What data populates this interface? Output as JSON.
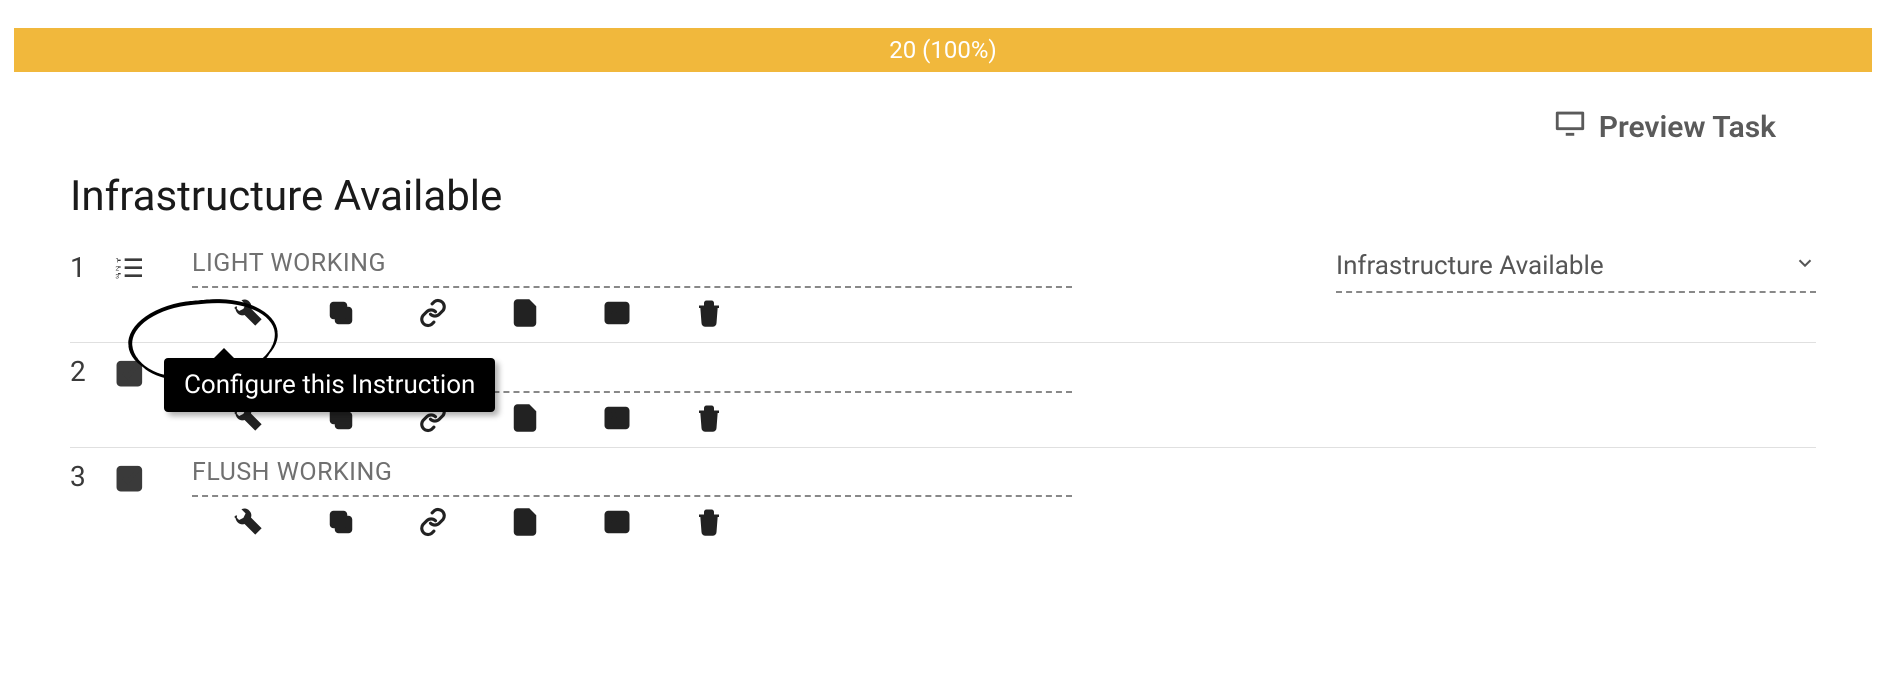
{
  "progress": {
    "text": "20 (100%)"
  },
  "preview": {
    "label": "Preview Task"
  },
  "title": "Infrastructure Available",
  "tooltip": {
    "text": "Configure this Instruction"
  },
  "groupSelect": {
    "label": "Infrastructure Available"
  },
  "rows": [
    {
      "num": "1",
      "type": "list",
      "label": "LIGHT WORKING"
    },
    {
      "num": "2",
      "type": "check",
      "label": ""
    },
    {
      "num": "3",
      "type": "check",
      "label": "FLUSH WORKING"
    }
  ],
  "icons": {
    "configure": "wrench-icon",
    "copy": "copy-icon",
    "link": "link-icon",
    "document": "document-icon",
    "image": "image-icon",
    "delete": "trash-icon"
  }
}
